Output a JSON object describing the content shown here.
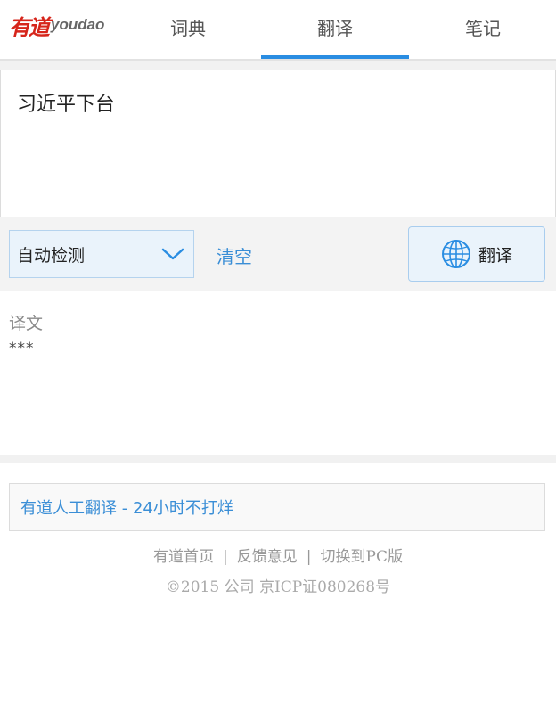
{
  "header": {
    "logo_cn": "有道",
    "logo_en": "youdao",
    "tabs": [
      {
        "label": "词典"
      },
      {
        "label": "翻译"
      },
      {
        "label": "笔记"
      }
    ]
  },
  "input": {
    "value": "习近平下台"
  },
  "controls": {
    "language": "自动检测",
    "clear_label": "清空",
    "translate_label": "翻译"
  },
  "result": {
    "label": "译文",
    "text": "***"
  },
  "human_translation": {
    "text": "有道人工翻译 - 24小时不打烊"
  },
  "footer": {
    "links": [
      "有道首页",
      "反馈意见",
      "切换到PC版"
    ],
    "separator": "|",
    "copyright": "©2015 公司 京ICP证080268号"
  },
  "colors": {
    "accent": "#2a8de2",
    "brand_red": "#d6251b",
    "link_blue": "#3a8ed6"
  }
}
